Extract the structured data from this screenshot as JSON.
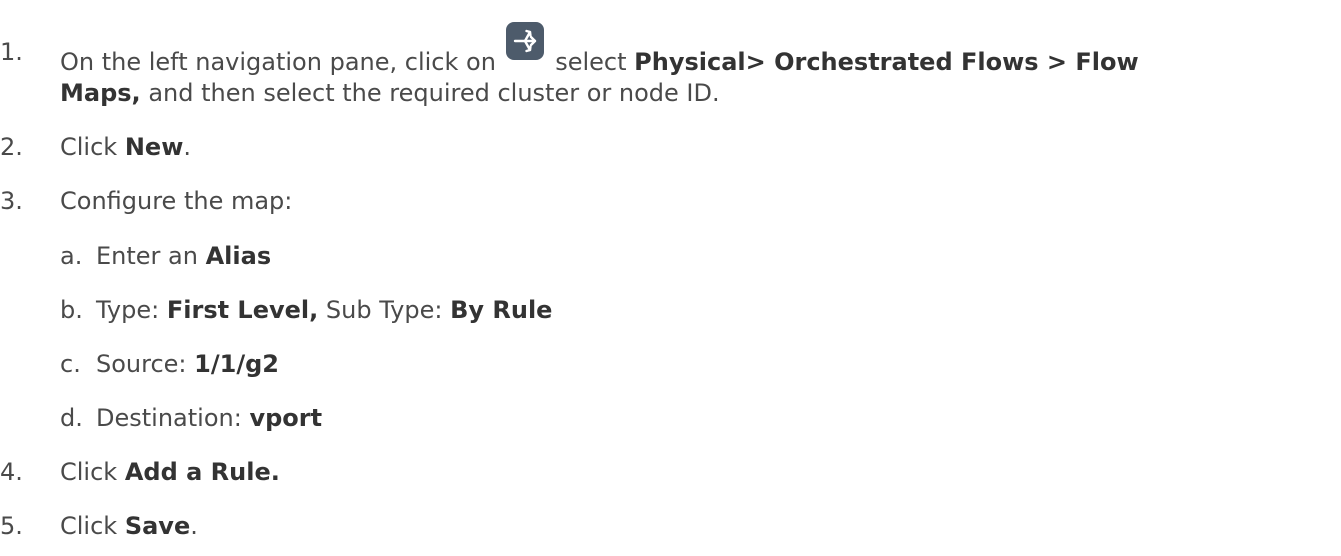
{
  "steps": {
    "s1": {
      "num": "1.",
      "pre": "On the left navigation pane, click on",
      "mid": "select",
      "path": "Physical> Orchestrated Flows > Flow",
      "path_cont": "Maps,",
      "tail": "and then select the required cluster or node ID.",
      "icon": "flow-maps-icon"
    },
    "s2": {
      "num": "2.",
      "pre": "Click",
      "bold": "New",
      "post": "."
    },
    "s3": {
      "num": "3.",
      "text": "Configure the map:"
    },
    "sa": {
      "num": "a.",
      "pre": "Enter an",
      "bold": "Alias"
    },
    "sb": {
      "num": "b.",
      "pre": "Type:",
      "bold1": "First Level,",
      "mid": "Sub Type:",
      "bold2": "By Rule"
    },
    "sc": {
      "num": "c.",
      "pre": "Source:",
      "bold": "1/1/g2"
    },
    "sd": {
      "num": "d.",
      "pre": "Destination:",
      "bold": "vport"
    },
    "s4": {
      "num": "4.",
      "pre": "Click",
      "bold": "Add a Rule."
    },
    "s5": {
      "num": "5.",
      "pre": "Click",
      "bold": "Save",
      "post": "."
    }
  },
  "colors": {
    "text": "#4a4a4a",
    "bold_text": "#333333",
    "icon_bg": "#4d5b6b",
    "icon_fg": "#ffffff"
  }
}
